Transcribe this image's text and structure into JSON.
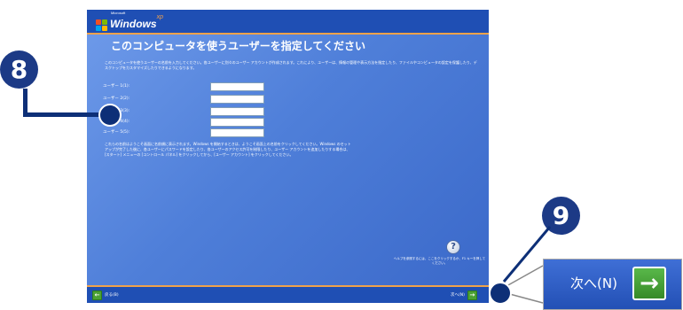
{
  "logo": {
    "small": "Microsoft",
    "main": "Windows",
    "xp": "xp"
  },
  "title": "このコンピュータを使うユーザーを指定してください",
  "intro": "このコンピュータを使うユーザーの名前を入力してください。各ユーザーに別々のユーザー アカウントが作成されます。これにより、ユーザーは、情報の管理や表示方法を指定したり、ファイルやコンピュータの設定を保護したり、デスクトップをカスタマイズしたりできるようになります。",
  "users": [
    {
      "label": "ユーザー 1(1):",
      "value": ""
    },
    {
      "label": "ユーザー 2(2):",
      "value": ""
    },
    {
      "label": "ユーザー 3(3):",
      "value": ""
    },
    {
      "label": "ユーザー 4(4):",
      "value": ""
    },
    {
      "label": "ユーザー 5(5):",
      "value": ""
    }
  ],
  "explain": "これらの名前はようこそ画面に名前順に表示されます。Windows を開始するときは、ようこそ画面上の名前をクリックしてください。Windows のセットアップが完了した後に、各ユーザーにパスワードを設定したり、各ユーザーのアクセス許可を制限したり、ユーザー アカウントを追加したりする場合は、[スタート] メニューの [コントロール パネル] をクリックしてから、[ユーザー アカウント] をクリックしてください。",
  "help": {
    "icon": "?",
    "text": "ヘルプを参照するには、ここをクリックするか、F1 キーを押してください。"
  },
  "nav": {
    "back_label": "戻る(B)",
    "next_label": "次へ(N)"
  },
  "callouts": {
    "eight": "8",
    "nine": "9"
  },
  "zoom": {
    "next_label": "次へ(N)"
  },
  "icons": {
    "back": "arrow-left-icon",
    "next": "arrow-right-icon",
    "help": "help-icon"
  },
  "colors": {
    "bar_blue": "#1f4fb4",
    "accent_orange": "#f0a24a",
    "callout_navy": "#1c3a86",
    "arrow_green": "#4ba134"
  }
}
